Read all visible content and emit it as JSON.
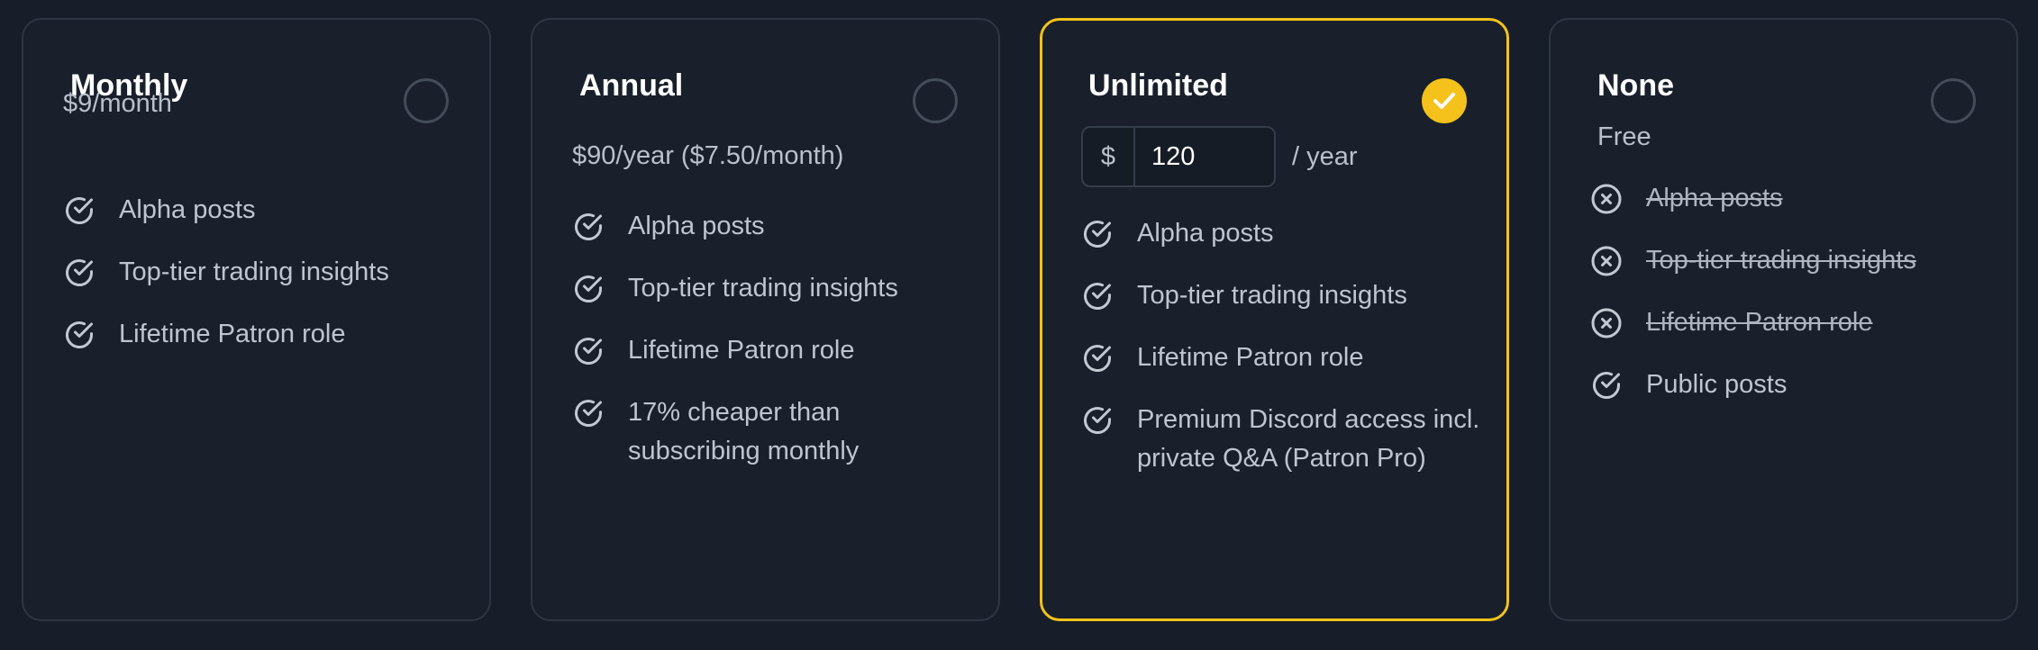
{
  "accent_color": "#f4c21a",
  "plans": [
    {
      "title": "Monthly",
      "price": "$9/month",
      "selected": false,
      "features": [
        {
          "label": "Alpha posts",
          "icon": "check-circle-icon",
          "included": true
        },
        {
          "label": "Top-tier trading insights",
          "icon": "check-circle-icon",
          "included": true
        },
        {
          "label": "Lifetime Patron role",
          "icon": "check-circle-icon",
          "included": true
        }
      ]
    },
    {
      "title": "Annual",
      "price": "$90/year ($7.50/month)",
      "selected": false,
      "features": [
        {
          "label": "Alpha posts",
          "icon": "check-circle-icon",
          "included": true
        },
        {
          "label": "Top-tier trading insights",
          "icon": "check-circle-icon",
          "included": true
        },
        {
          "label": "Lifetime Patron role",
          "icon": "check-circle-icon",
          "included": true
        },
        {
          "label": "17% cheaper than subscribing monthly",
          "icon": "check-circle-icon",
          "included": true
        }
      ]
    },
    {
      "title": "Unlimited",
      "selected": true,
      "currency_symbol": "$",
      "amount_value": "120",
      "period_label": "/ year",
      "features": [
        {
          "label": "Alpha posts",
          "icon": "check-circle-icon",
          "included": true
        },
        {
          "label": "Top-tier trading insights",
          "icon": "check-circle-icon",
          "included": true
        },
        {
          "label": "Lifetime Patron role",
          "icon": "check-circle-icon",
          "included": true
        },
        {
          "label": "Premium Discord access incl. private Q&A (Patron Pro)",
          "icon": "check-circle-icon",
          "included": true
        }
      ]
    },
    {
      "title": "None",
      "price": "Free",
      "selected": false,
      "features": [
        {
          "label": "Alpha posts",
          "icon": "x-circle-icon",
          "included": false
        },
        {
          "label": "Top-tier trading insights",
          "icon": "x-circle-icon",
          "included": false
        },
        {
          "label": "Lifetime Patron role",
          "icon": "x-circle-icon",
          "included": false
        },
        {
          "label": "Public posts",
          "icon": "check-circle-icon",
          "included": true
        }
      ]
    }
  ]
}
